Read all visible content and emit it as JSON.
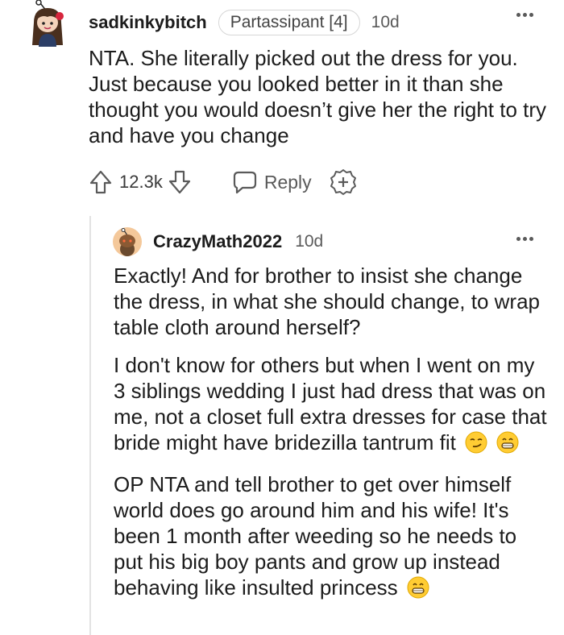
{
  "comment": {
    "username": "sadkinkybitch",
    "flair": "Partassipant [4]",
    "timestamp": "10d",
    "body": "NTA. She literally picked out the dress for you. Just because you looked better in it than she thought you would doesn’t give her the right to try and have you change",
    "vote_count": "12.3k",
    "reply_label": "Reply"
  },
  "reply": {
    "username": "CrazyMath2022",
    "timestamp": "10d",
    "paragraphs": [
      "Exactly! And for brother to insist she change the dress, in what she should change, to wrap table cloth around herself?",
      "I don't know for others but when I went on my 3 siblings wedding I just had dress that was on me, not a closet full extra dresses for case that bride might have bridezilla tantrum fit",
      "OP NTA and tell brother to get over himself world does go around him and his wife! It's been 1 month after weeding so he needs to put his big boy pants and grow up instead behaving like insulted princess"
    ]
  },
  "icons": {
    "upvote": "arrow-up-icon",
    "downvote": "arrow-down-icon",
    "reply": "speech-bubble-icon",
    "award": "plus-badge-icon",
    "more": "more-dots-icon",
    "emoji_smirk": "smirking-face-emoji",
    "emoji_grin": "grinning-face-emoji"
  },
  "colors": {
    "text": "#1c1c1c",
    "meta": "#5a5a5a",
    "thread_line": "#e3e3e3",
    "avatar_reply_bg": "#f4c89a"
  }
}
